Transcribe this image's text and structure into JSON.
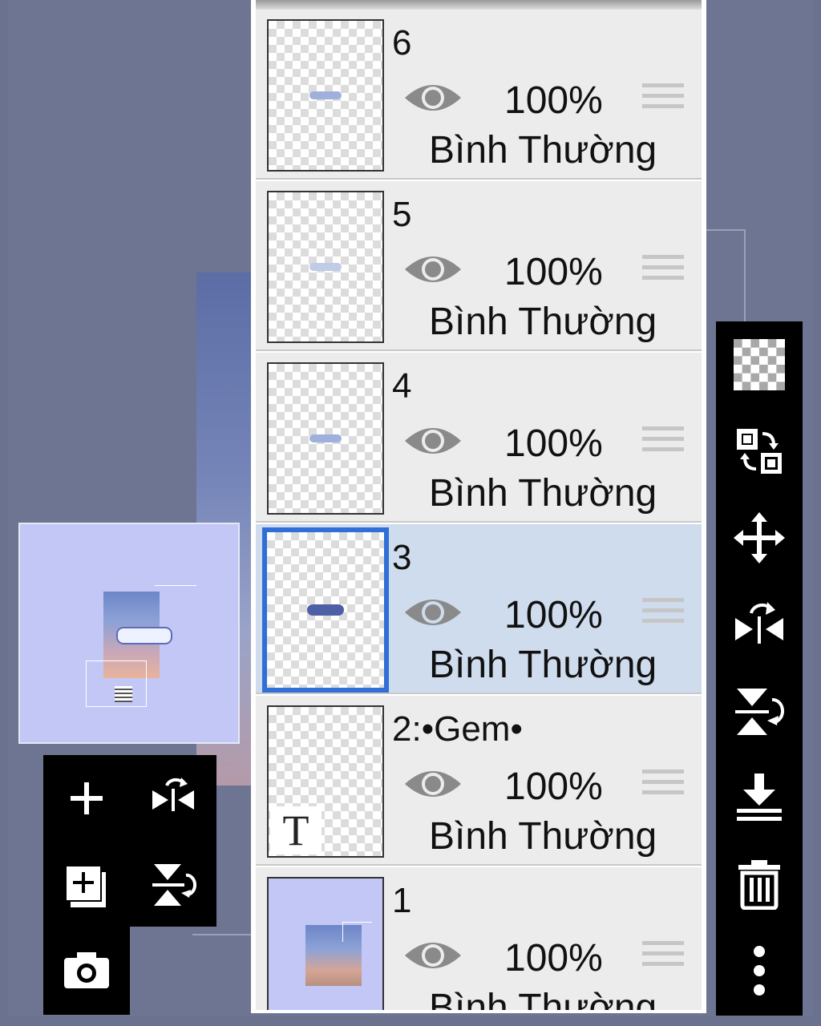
{
  "layers": [
    {
      "name": "6",
      "opacity": "100%",
      "blend_mode": "Bình Thường"
    },
    {
      "name": "5",
      "opacity": "100%",
      "blend_mode": "Bình Thường"
    },
    {
      "name": "4",
      "opacity": "100%",
      "blend_mode": "Bình Thường"
    },
    {
      "name": "3",
      "opacity": "100%",
      "blend_mode": "Bình Thường"
    },
    {
      "name": "2:•Gem•",
      "opacity": "100%",
      "blend_mode": "Bình Thường",
      "thumb_letter": "T"
    },
    {
      "name": "1",
      "opacity": "100%",
      "blend_mode": "Bình Thường"
    }
  ],
  "selected_layer": "3",
  "colors": {
    "selected_row": "#cfdcee",
    "selected_border": "#2f6fd6",
    "navigator_bg": "#c2c7f5"
  },
  "left_toolbar": [
    "add-layer-icon",
    "flip-horizontal-icon",
    "add-layer-copy-icon",
    "flip-vertical-icon",
    "camera-icon"
  ],
  "right_toolbar": [
    "transparency-icon",
    "swap-layers-icon",
    "move-icon",
    "flip-horizontal-icon",
    "flip-vertical-icon",
    "merge-down-icon",
    "trash-icon",
    "more-icon"
  ]
}
